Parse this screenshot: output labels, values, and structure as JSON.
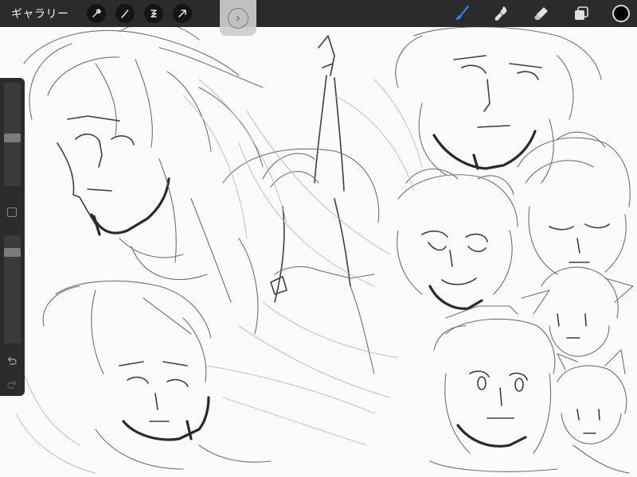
{
  "toolbar": {
    "gallery_label": "ギャラリー",
    "left_tools": [
      "wrench-icon",
      "magic-wand-icon",
      "selection-icon",
      "transform-arrow-icon"
    ],
    "right_tools": [
      "brush-icon",
      "smudge-icon",
      "eraser-icon",
      "layers-icon"
    ],
    "active_tool": "brush",
    "active_tool_color": "#2f7ff5",
    "current_color": "#000000"
  },
  "sidebar": {
    "brush_size": 0.46,
    "opacity": 0.13
  },
  "colors": {
    "chrome": "#2b2b2b",
    "canvas": "#fbfbfb"
  }
}
